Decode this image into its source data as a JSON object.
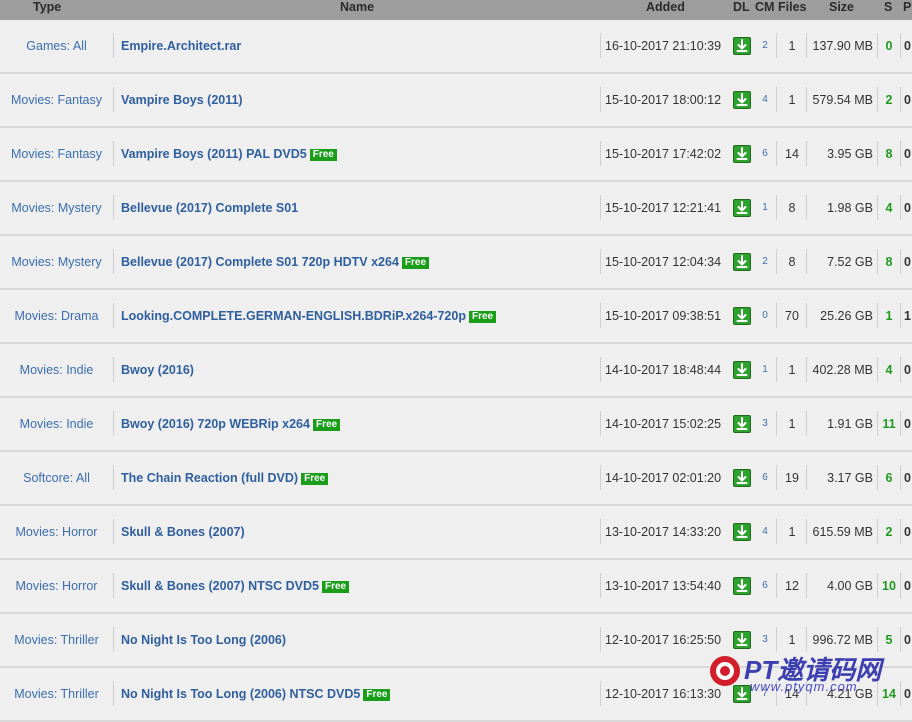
{
  "header": {
    "type": "Type",
    "name": "Name",
    "added": "Added",
    "dl": "DL",
    "cm": "CM",
    "files": "Files",
    "size": "Size",
    "seeders": "S",
    "peers": "P"
  },
  "free_badge": "Free",
  "rows": [
    {
      "type": "Games: All",
      "name": "Empire.Architect.rar",
      "free": false,
      "added": "16-10-2017 21:10:39",
      "cm": "2",
      "files": "1",
      "size": "137.90 MB",
      "seeders": "0",
      "peers": "0"
    },
    {
      "type": "Movies: Fantasy",
      "name": "Vampire Boys (2011)",
      "free": false,
      "added": "15-10-2017 18:00:12",
      "cm": "4",
      "files": "1",
      "size": "579.54 MB",
      "seeders": "2",
      "peers": "0"
    },
    {
      "type": "Movies: Fantasy",
      "name": "Vampire Boys (2011) PAL DVD5",
      "free": true,
      "added": "15-10-2017 17:42:02",
      "cm": "6",
      "files": "14",
      "size": "3.95 GB",
      "seeders": "8",
      "peers": "0"
    },
    {
      "type": "Movies: Mystery",
      "name": "Bellevue (2017) Complete S01",
      "free": false,
      "added": "15-10-2017 12:21:41",
      "cm": "1",
      "files": "8",
      "size": "1.98 GB",
      "seeders": "4",
      "peers": "0"
    },
    {
      "type": "Movies: Mystery",
      "name": "Bellevue (2017) Complete S01 720p HDTV x264",
      "free": true,
      "added": "15-10-2017 12:04:34",
      "cm": "2",
      "files": "8",
      "size": "7.52 GB",
      "seeders": "8",
      "peers": "0"
    },
    {
      "type": "Movies: Drama",
      "name": "Looking.COMPLETE.GERMAN-ENGLISH.BDRiP.x264-720p",
      "free": true,
      "added": "15-10-2017 09:38:51",
      "cm": "0",
      "files": "70",
      "size": "25.26 GB",
      "seeders": "1",
      "peers": "1"
    },
    {
      "type": "Movies: Indie",
      "name": "Bwoy (2016)",
      "free": false,
      "added": "14-10-2017 18:48:44",
      "cm": "1",
      "files": "1",
      "size": "402.28 MB",
      "seeders": "4",
      "peers": "0"
    },
    {
      "type": "Movies: Indie",
      "name": "Bwoy (2016) 720p WEBRip x264",
      "free": true,
      "added": "14-10-2017 15:02:25",
      "cm": "3",
      "files": "1",
      "size": "1.91 GB",
      "seeders": "11",
      "peers": "0"
    },
    {
      "type": "Softcore: All",
      "name": "The Chain Reaction (full DVD)",
      "free": true,
      "added": "14-10-2017 02:01:20",
      "cm": "6",
      "files": "19",
      "size": "3.17 GB",
      "seeders": "6",
      "peers": "0"
    },
    {
      "type": "Movies: Horror",
      "name": "Skull & Bones (2007)",
      "free": false,
      "added": "13-10-2017 14:33:20",
      "cm": "4",
      "files": "1",
      "size": "615.59 MB",
      "seeders": "2",
      "peers": "0"
    },
    {
      "type": "Movies: Horror",
      "name": "Skull & Bones (2007) NTSC DVD5",
      "free": true,
      "added": "13-10-2017 13:54:40",
      "cm": "6",
      "files": "12",
      "size": "4.00 GB",
      "seeders": "10",
      "peers": "0"
    },
    {
      "type": "Movies: Thriller",
      "name": "No Night Is Too Long (2006)",
      "free": false,
      "added": "12-10-2017 16:25:50",
      "cm": "3",
      "files": "1",
      "size": "996.72 MB",
      "seeders": "5",
      "peers": "0"
    },
    {
      "type": "Movies: Thriller",
      "name": "No Night Is Too Long (2006) NTSC DVD5",
      "free": true,
      "added": "12-10-2017 16:13:30",
      "cm": "7",
      "files": "14",
      "size": "4.21 GB",
      "seeders": "14",
      "peers": "0"
    }
  ],
  "watermark": {
    "title": "PT邀请码网",
    "url": "www.ptyqm.com"
  },
  "colors": {
    "header_bg": "#9d9d9d",
    "row_bg": "#efefef",
    "link": "#2f5f9e",
    "free_badge": "#1a9e1a",
    "seeders": "#1f9a1f"
  }
}
